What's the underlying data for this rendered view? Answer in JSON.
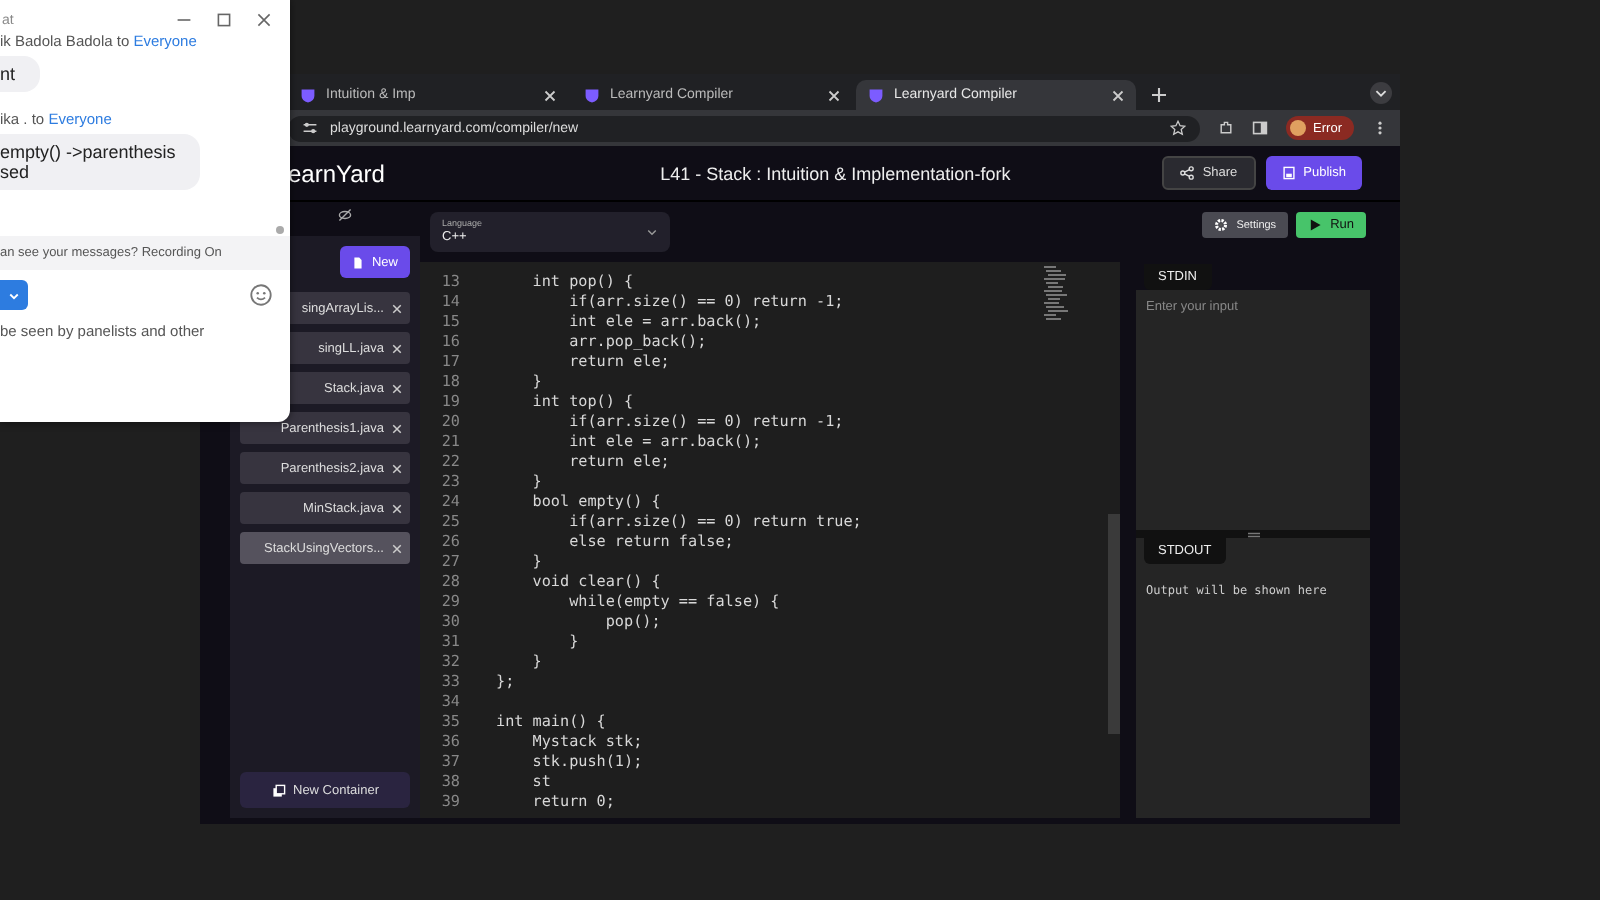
{
  "chat": {
    "title": "at",
    "messages": [
      {
        "sender": "ik Badola Badola to",
        "audience": "Everyone",
        "lines": [
          "nt"
        ]
      },
      {
        "sender": "ika . to",
        "audience": "Everyone",
        "lines": [
          "empty() ->parenthesis",
          "sed"
        ]
      }
    ],
    "notice": "an see your messages? Recording On",
    "footer": "be seen by panelists and other"
  },
  "browser": {
    "tabs": [
      {
        "title": "Intuition & Imp",
        "selected": false
      },
      {
        "title": "Learnyard Compiler",
        "selected": false
      },
      {
        "title": "Learnyard Compiler",
        "selected": true
      }
    ],
    "url": "playground.learnyard.com/compiler/new",
    "profile": "Error"
  },
  "app": {
    "logo": "earnYard",
    "title": "L41 - Stack : Intuition & Implementation-fork",
    "share": "Share",
    "publish": "Publish",
    "language": {
      "label": "Language",
      "value": "C++"
    },
    "settings": "Settings",
    "run": "Run",
    "new": "New",
    "files": [
      {
        "name": "singArrayLis...",
        "selected": false
      },
      {
        "name": "singLL.java",
        "selected": false
      },
      {
        "name": "Stack.java",
        "selected": false
      },
      {
        "name": "Parenthesis1.java",
        "selected": false
      },
      {
        "name": "Parenthesis2.java",
        "selected": false
      },
      {
        "name": "MinStack.java",
        "selected": false
      },
      {
        "name": "StackUsingVectors...",
        "selected": true
      }
    ],
    "new_container": "New Container",
    "code": [
      {
        "n": "13",
        "text": "    int pop() {"
      },
      {
        "n": "14",
        "text": "        if(arr.size() == 0) return -1;"
      },
      {
        "n": "15",
        "text": "        int ele = arr.back();"
      },
      {
        "n": "16",
        "text": "        arr.pop_back();"
      },
      {
        "n": "17",
        "text": "        return ele;"
      },
      {
        "n": "18",
        "text": "    }"
      },
      {
        "n": "19",
        "text": "    int top() {"
      },
      {
        "n": "20",
        "text": "        if(arr.size() == 0) return -1;"
      },
      {
        "n": "21",
        "text": "        int ele = arr.back();"
      },
      {
        "n": "22",
        "text": "        return ele;"
      },
      {
        "n": "23",
        "text": "    }"
      },
      {
        "n": "24",
        "text": "    bool empty() {"
      },
      {
        "n": "25",
        "text": "        if(arr.size() == 0) return true;"
      },
      {
        "n": "26",
        "text": "        else return false;"
      },
      {
        "n": "27",
        "text": "    }"
      },
      {
        "n": "28",
        "text": "    void clear() {"
      },
      {
        "n": "29",
        "text": "        while(empty == false) {"
      },
      {
        "n": "30",
        "text": "            pop();"
      },
      {
        "n": "31",
        "text": "        }"
      },
      {
        "n": "32",
        "text": "    }"
      },
      {
        "n": "33",
        "text": "};"
      },
      {
        "n": "34"
      },
      {
        "n": "35",
        "text": "int main() {"
      },
      {
        "n": "36",
        "text": "    Mystack stk;"
      },
      {
        "n": "37",
        "text": "    stk.push(1);"
      },
      {
        "n": "38",
        "text": "    st"
      },
      {
        "n": "39",
        "text": "    return 0;"
      }
    ],
    "stdin": {
      "label": "STDIN",
      "placeholder": "Enter your input"
    },
    "stdout": {
      "label": "STDOUT",
      "output": "Output will be shown here"
    }
  }
}
